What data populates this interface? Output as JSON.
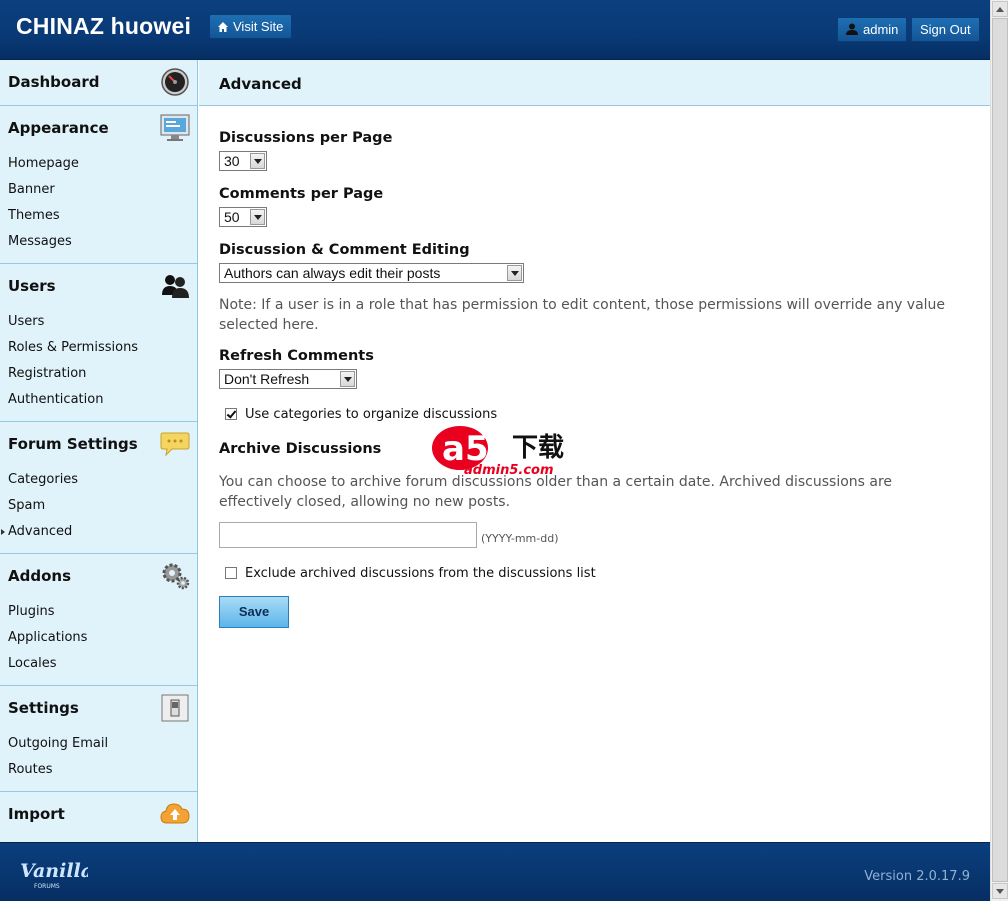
{
  "header": {
    "site_title": "CHINAZ huowei",
    "visit_site_label": "Visit Site",
    "user_label": "admin",
    "sign_out_label": "Sign Out"
  },
  "sidebar": {
    "sections": [
      {
        "label": "Dashboard",
        "icon": "dashboard-gauge-icon",
        "items": []
      },
      {
        "label": "Appearance",
        "icon": "monitor-icon",
        "items": [
          "Homepage",
          "Banner",
          "Themes",
          "Messages"
        ]
      },
      {
        "label": "Users",
        "icon": "users-icon",
        "items": [
          "Users",
          "Roles & Permissions",
          "Registration",
          "Authentication"
        ]
      },
      {
        "label": "Forum Settings",
        "icon": "speech-bubble-icon",
        "items": [
          "Categories",
          "Spam",
          "Advanced"
        ]
      },
      {
        "label": "Addons",
        "icon": "gears-icon",
        "items": [
          "Plugins",
          "Applications",
          "Locales"
        ]
      },
      {
        "label": "Settings",
        "icon": "switch-icon",
        "items": [
          "Outgoing Email",
          "Routes"
        ]
      },
      {
        "label": "Import",
        "icon": "cloud-upload-icon",
        "items": []
      }
    ],
    "active_item": "Advanced"
  },
  "content": {
    "title": "Advanced",
    "discussions_per_page": {
      "label": "Discussions per Page",
      "value": "30"
    },
    "comments_per_page": {
      "label": "Comments per Page",
      "value": "50"
    },
    "editing": {
      "label": "Discussion & Comment Editing",
      "value": "Authors can always edit their posts"
    },
    "editing_note": "Note: If a user is in a role that has permission to edit content, those permissions will override any value selected here.",
    "refresh": {
      "label": "Refresh Comments",
      "value": "Don't Refresh"
    },
    "use_categories": {
      "label": "Use categories to organize discussions",
      "checked": true
    },
    "archive": {
      "label": "Archive Discussions",
      "note": "You can choose to archive forum discussions older than a certain date. Archived discussions are effectively closed, allowing no new posts.",
      "date_value": "",
      "date_hint": "(YYYY-mm-dd)"
    },
    "exclude_archived": {
      "label": "Exclude archived discussions from the discussions list",
      "checked": false
    },
    "save_label": "Save"
  },
  "watermark": {
    "brand": "a5",
    "cn": "下载",
    "site": "admin5.com"
  },
  "footer": {
    "logo_text": "Vanilla",
    "logo_sub": "FORUMS",
    "version": "Version 2.0.17.9"
  },
  "colors": {
    "header_bg": "#0b3f7e",
    "sidebar_bg": "#e0f3fb",
    "save_button": "#5cb5ea",
    "watermark_red": "#e8001e"
  }
}
